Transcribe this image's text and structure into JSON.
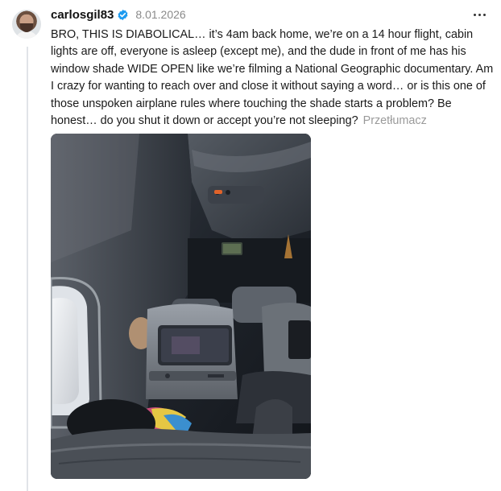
{
  "post": {
    "author": {
      "username": "carlosgil83",
      "verified": true
    },
    "date": "8.01.2026",
    "text": "BRO, THIS IS DIABOLICAL… it’s 4am back home, we’re on a 14 hour flight, cabin lights are off, everyone is asleep (except me), and the dude in front of me has his window shade WIDE OPEN like we’re filming a National Geographic documentary. Am I crazy for wanting to reach over and close it without saying a word… or is this one of those unspoken airplane rules where touching the shade starts a problem? Be honest… do you shut it down or accept you’re not sleeping?",
    "translate_label": "Przetłumacz"
  },
  "colors": {
    "verified_badge": "#1d9bf0",
    "text": "#1a1a1a",
    "muted": "#9a9a9a",
    "thread_line": "#e1e4e8"
  },
  "icons": {
    "verified": "verified-badge-icon",
    "more": "more-options-icon"
  }
}
